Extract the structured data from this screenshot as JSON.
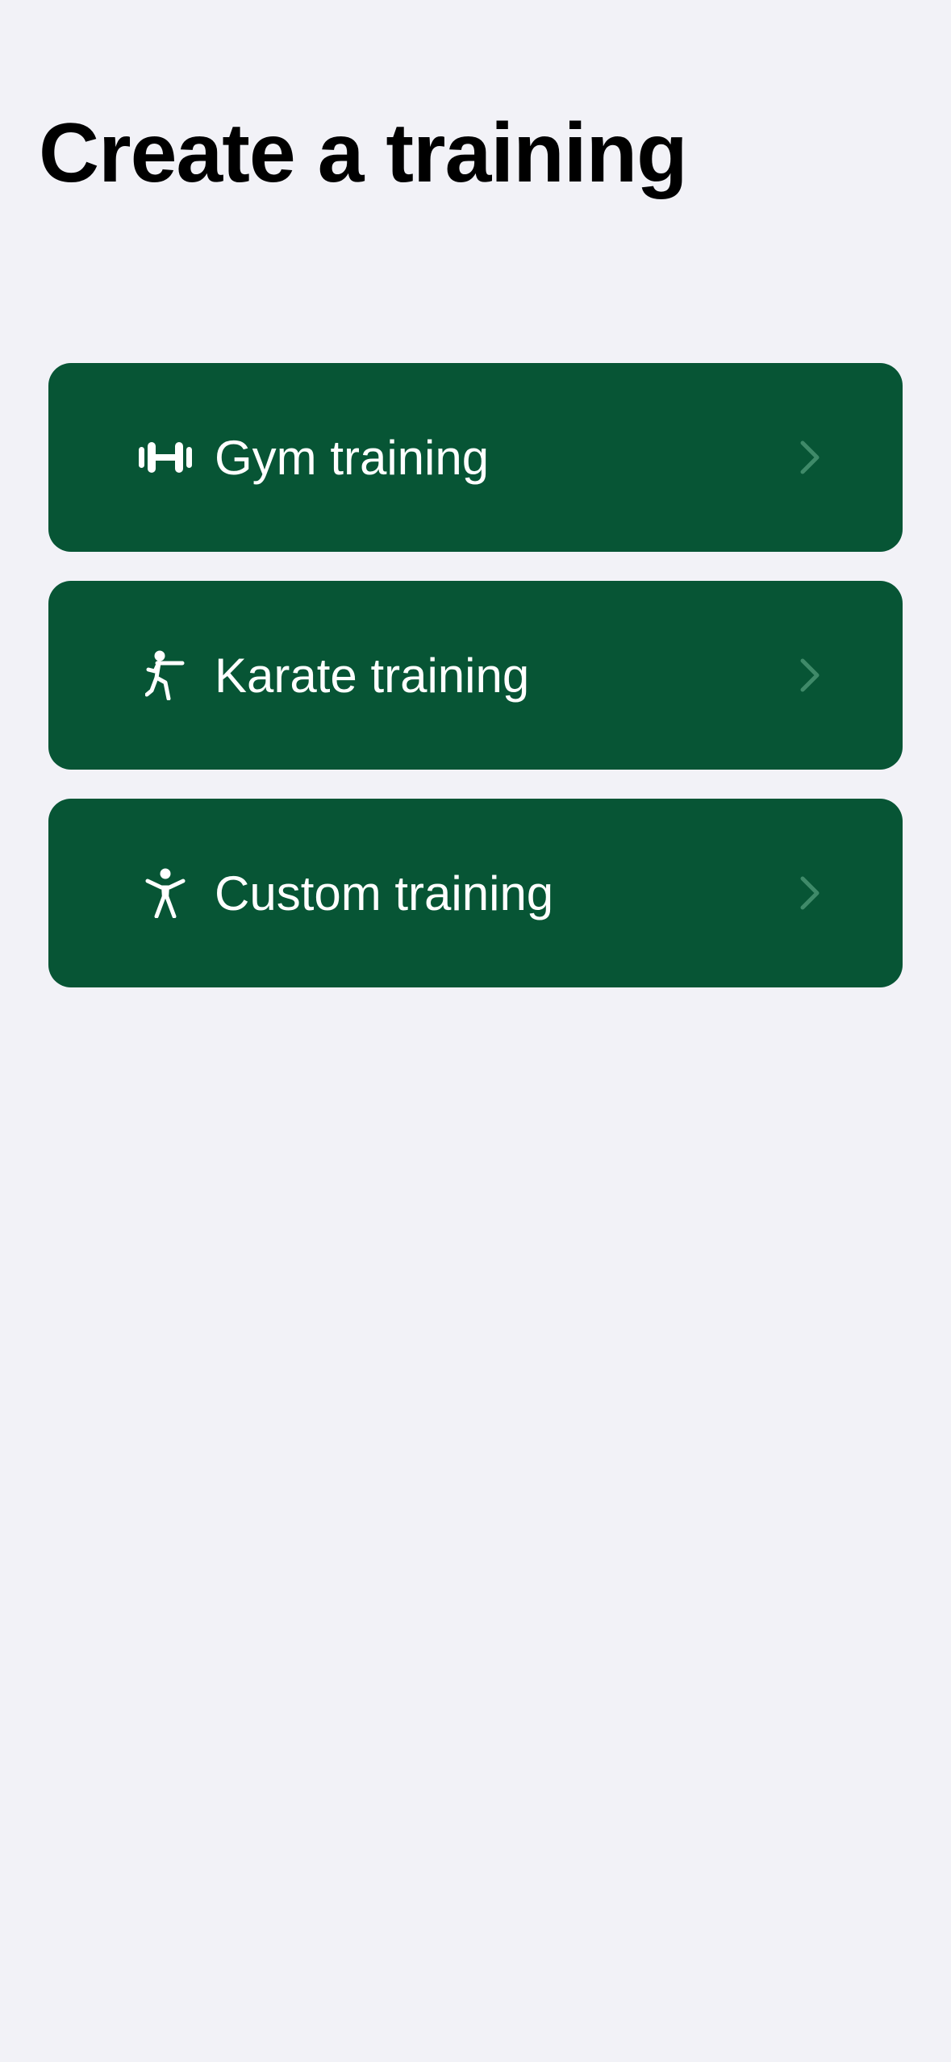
{
  "header": {
    "title": "Create a training"
  },
  "options": [
    {
      "label": "Gym training",
      "icon": "dumbbell-icon"
    },
    {
      "label": "Karate training",
      "icon": "martial-arts-figure-icon"
    },
    {
      "label": "Custom training",
      "icon": "person-arms-up-icon"
    }
  ],
  "colors": {
    "background": "#f2f2f7",
    "card": "#075535",
    "card_text": "#ffffff",
    "chevron": "#3f8a69",
    "title": "#000000"
  }
}
